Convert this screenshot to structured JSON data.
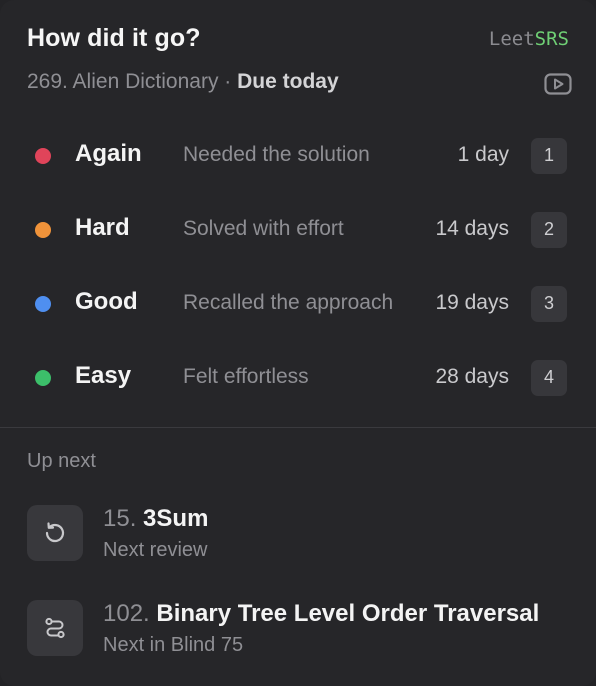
{
  "header": {
    "title": "How did it go?",
    "brand_leet": "Leet",
    "brand_srs": "SRS",
    "problem": "269. Alien Dictionary",
    "separator": "·",
    "due": "Due today",
    "video_icon": "play-rect-icon"
  },
  "ratings": [
    {
      "label": "Again",
      "desc": "Needed the solution",
      "interval": "1 day",
      "key": "1",
      "color": "#e0445a"
    },
    {
      "label": "Hard",
      "desc": "Solved with effort",
      "interval": "14 days",
      "key": "2",
      "color": "#f0933a"
    },
    {
      "label": "Good",
      "desc": "Recalled the approach",
      "interval": "19 days",
      "key": "3",
      "color": "#4f8ff0"
    },
    {
      "label": "Easy",
      "desc": "Felt effortless",
      "interval": "28 days",
      "key": "4",
      "color": "#3cbf6a"
    }
  ],
  "up_next": {
    "label": "Up next",
    "items": [
      {
        "number": "15.",
        "name": "3Sum",
        "sub": "Next review",
        "icon": "rotate-ccw-icon"
      },
      {
        "number": "102.",
        "name": "Binary Tree Level Order Traversal",
        "sub": "Next in Blind 75",
        "icon": "route-icon"
      }
    ]
  }
}
